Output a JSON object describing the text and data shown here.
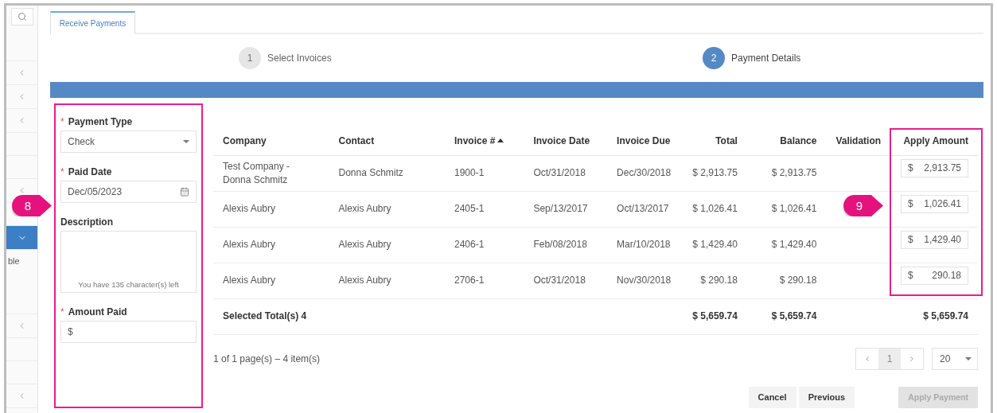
{
  "sidebar": {
    "items": [
      {
        "kind": "search",
        "selected": false
      },
      {
        "kind": "collapse",
        "selected": false
      },
      {
        "kind": "collapse",
        "selected": false
      },
      {
        "kind": "collapse",
        "selected": false
      },
      {
        "kind": "blank",
        "selected": false
      },
      {
        "kind": "blank",
        "selected": false
      },
      {
        "kind": "collapse",
        "selected": false
      },
      {
        "kind": "blank",
        "selected": false
      },
      {
        "kind": "expand",
        "selected": true
      },
      {
        "kind": "text",
        "label": "ble",
        "selected": false
      },
      {
        "kind": "collapse",
        "selected": false
      },
      {
        "kind": "blank",
        "selected": false
      },
      {
        "kind": "blank",
        "selected": false
      },
      {
        "kind": "collapse",
        "selected": false
      }
    ]
  },
  "tabs": [
    {
      "label": "Receive Payments",
      "selected": true
    }
  ],
  "steps": [
    {
      "number": "1",
      "label": "Select Invoices",
      "selected": false
    },
    {
      "number": "2",
      "label": "Payment Details",
      "selected": true
    }
  ],
  "form": {
    "fields": [
      {
        "kind": "select",
        "label": "Payment Type",
        "required_mark": "*",
        "value": "Check"
      },
      {
        "kind": "date",
        "label": "Paid Date",
        "required_mark": "*",
        "value": "Dec/05/2023"
      },
      {
        "kind": "textarea",
        "label": "Description",
        "hint": "You have 135 character(s) left"
      },
      {
        "kind": "money",
        "label": "Amount Paid",
        "required_mark": "*",
        "prefix": "$"
      }
    ]
  },
  "progress": {
    "level": 1
  },
  "table": {
    "columns": [
      {
        "label": "Company",
        "sorted": false
      },
      {
        "label": "Contact",
        "sorted": false
      },
      {
        "label": "Invoice #",
        "sorted": true
      },
      {
        "label": "Invoice Date",
        "sorted": false
      },
      {
        "label": "Invoice Due",
        "sorted": false
      },
      {
        "label": "Total",
        "sorted": false
      },
      {
        "label": "Balance",
        "sorted": false
      },
      {
        "label": "Validation",
        "sorted": false
      },
      {
        "label": "Apply Amount",
        "sorted": false
      }
    ],
    "rows": [
      {
        "cells": [
          "Test Company - Donna Schmitz",
          "Donna Schmitz",
          "1900-1",
          "Oct/31/2018",
          "Dec/30/2018",
          "$ 2,913.75",
          "$ 2,913.75"
        ],
        "apply": {
          "prefix": "$",
          "value": "2,913.75"
        }
      },
      {
        "cells": [
          "Alexis Aubry",
          "Alexis Aubry",
          "2405-1",
          "Sep/13/2017",
          "Oct/13/2017",
          "$ 1,026.41",
          "$ 1,026.41"
        ],
        "apply": {
          "prefix": "$",
          "value": "1,026.41"
        }
      },
      {
        "cells": [
          "Alexis Aubry",
          "Alexis Aubry",
          "2406-1",
          "Feb/08/2018",
          "Mar/10/2018",
          "$ 1,429.40",
          "$ 1,429.40"
        ],
        "apply": {
          "prefix": "$",
          "value": "1,429.40"
        }
      },
      {
        "cells": [
          "Alexis Aubry",
          "Alexis Aubry",
          "2706-1",
          "Oct/31/2018",
          "Nov/30/2018",
          "$ 290.18",
          "$ 290.18"
        ],
        "apply": {
          "prefix": "$",
          "value": "290.18"
        }
      }
    ],
    "totals": {
      "label": "Selected Total(s) 4",
      "total": "$ 5,659.74",
      "balance": "$ 5,659.74",
      "apply": "$ 5,659.74"
    }
  },
  "pagination": {
    "summary": "1 of 1 page(s) – 4 item(s)",
    "pages": [
      {
        "label": "1",
        "selected": true
      }
    ],
    "page_size": "20"
  },
  "buttons": [
    {
      "label": "Cancel",
      "disabled": false
    },
    {
      "label": "Previous",
      "disabled": false
    },
    {
      "label": "Apply Payment",
      "disabled": true
    }
  ],
  "callouts": [
    {
      "number": "8"
    },
    {
      "number": "9"
    }
  ]
}
